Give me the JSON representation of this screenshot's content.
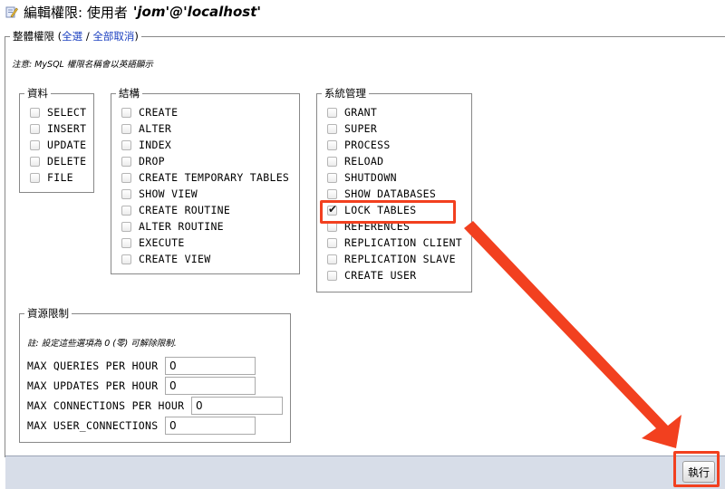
{
  "header": {
    "title_prefix": "編輯權限: 使用者",
    "user": "'jom'@'localhost'"
  },
  "global_privileges": {
    "legend_label": "整體權限",
    "paren_open": "(",
    "check_all": "全選",
    "separator": "/",
    "uncheck_all": "全部取消",
    "paren_close": ")",
    "note": "注意: MySQL 權限名稱會以英語顯示",
    "groups": [
      {
        "legend": "資料",
        "items": [
          {
            "label": "SELECT",
            "checked": false
          },
          {
            "label": "INSERT",
            "checked": false
          },
          {
            "label": "UPDATE",
            "checked": false
          },
          {
            "label": "DELETE",
            "checked": false
          },
          {
            "label": "FILE",
            "checked": false
          }
        ]
      },
      {
        "legend": "結構",
        "items": [
          {
            "label": "CREATE",
            "checked": false
          },
          {
            "label": "ALTER",
            "checked": false
          },
          {
            "label": "INDEX",
            "checked": false
          },
          {
            "label": "DROP",
            "checked": false
          },
          {
            "label": "CREATE TEMPORARY TABLES",
            "checked": false
          },
          {
            "label": "SHOW VIEW",
            "checked": false
          },
          {
            "label": "CREATE ROUTINE",
            "checked": false
          },
          {
            "label": "ALTER ROUTINE",
            "checked": false
          },
          {
            "label": "EXECUTE",
            "checked": false
          },
          {
            "label": "CREATE VIEW",
            "checked": false
          }
        ]
      },
      {
        "legend": "系統管理",
        "items": [
          {
            "label": "GRANT",
            "checked": false
          },
          {
            "label": "SUPER",
            "checked": false
          },
          {
            "label": "PROCESS",
            "checked": false
          },
          {
            "label": "RELOAD",
            "checked": false
          },
          {
            "label": "SHUTDOWN",
            "checked": false
          },
          {
            "label": "SHOW DATABASES",
            "checked": false
          },
          {
            "label": "LOCK TABLES",
            "checked": true
          },
          {
            "label": "REFERENCES",
            "checked": false
          },
          {
            "label": "REPLICATION CLIENT",
            "checked": false
          },
          {
            "label": "REPLICATION SLAVE",
            "checked": false
          },
          {
            "label": "CREATE USER",
            "checked": false
          }
        ]
      }
    ]
  },
  "resource_limits": {
    "legend": "資源限制",
    "note": "註: 設定這些選項為 0 (零) 可解除限制.",
    "fields": [
      {
        "label": "MAX QUERIES PER HOUR",
        "value": "0"
      },
      {
        "label": "MAX UPDATES PER HOUR",
        "value": "0"
      },
      {
        "label": "MAX CONNECTIONS PER HOUR",
        "value": "0"
      },
      {
        "label": "MAX USER_CONNECTIONS",
        "value": "0"
      }
    ]
  },
  "footer": {
    "go_label": "執行"
  },
  "colors": {
    "highlight": "#f2401f",
    "link": "#1a3fc0",
    "footer_bg": "#d7dde8"
  }
}
